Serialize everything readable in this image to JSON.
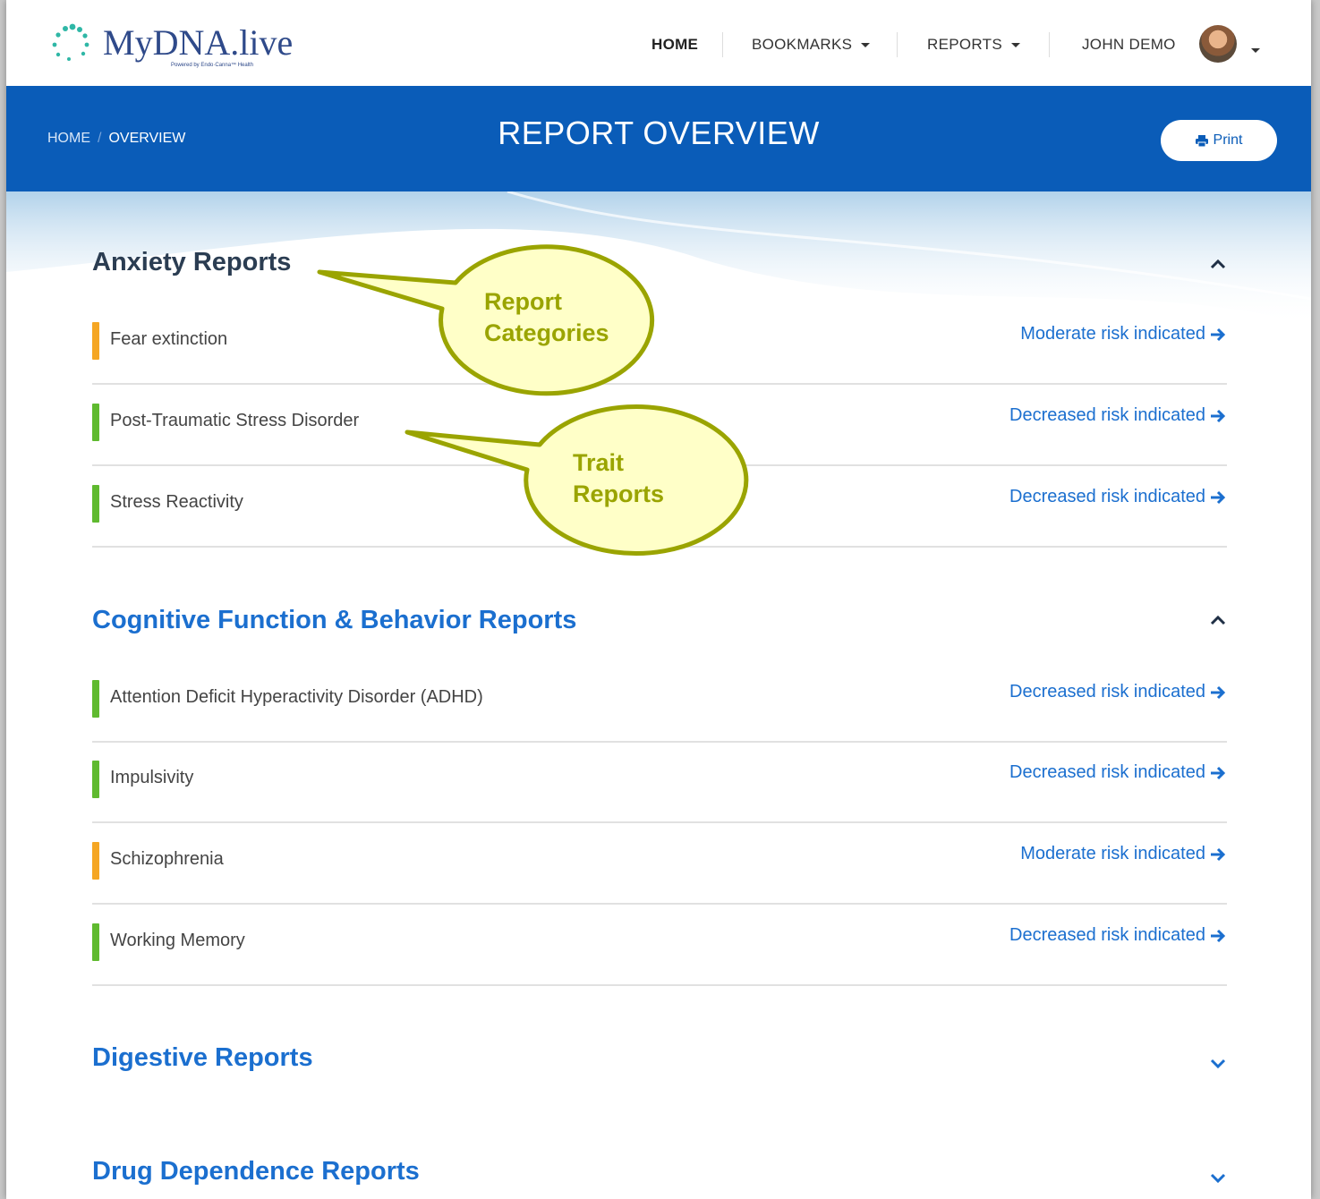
{
  "brand": {
    "name": "MyDNA",
    "tld": ".live",
    "tagline": "Powered by Endo·Canna™ Health"
  },
  "nav": {
    "home": "HOME",
    "bookmarks": "BOOKMARKS",
    "reports": "REPORTS",
    "user": "JOHN DEMO"
  },
  "header": {
    "breadcrumb_home": "HOME",
    "breadcrumb_sep": "/",
    "breadcrumb_current": "OVERVIEW",
    "title": "REPORT OVERVIEW",
    "print_label": "Print"
  },
  "colors": {
    "brand_blue": "#0a5cb8",
    "link_blue": "#1b6fcf",
    "moderate": "#f5a623",
    "decreased": "#5fba2f",
    "callout": "#9aa400"
  },
  "categories": [
    {
      "title": "Anxiety Reports",
      "expanded": true,
      "active": true,
      "traits": [
        {
          "name": "Fear extinction",
          "risk": "Moderate risk indicated",
          "level": "moderate"
        },
        {
          "name": "Post-Traumatic Stress Disorder",
          "risk": "Decreased risk indicated",
          "level": "decreased"
        },
        {
          "name": "Stress Reactivity",
          "risk": "Decreased risk indicated",
          "level": "decreased"
        }
      ]
    },
    {
      "title": "Cognitive Function & Behavior Reports",
      "expanded": true,
      "active": false,
      "traits": [
        {
          "name": "Attention Deficit Hyperactivity Disorder (ADHD)",
          "risk": "Decreased risk indicated",
          "level": "decreased"
        },
        {
          "name": "Impulsivity",
          "risk": "Decreased risk indicated",
          "level": "decreased"
        },
        {
          "name": "Schizophrenia",
          "risk": "Moderate risk indicated",
          "level": "moderate"
        },
        {
          "name": "Working Memory",
          "risk": "Decreased risk indicated",
          "level": "decreased"
        }
      ]
    },
    {
      "title": "Digestive Reports",
      "expanded": false,
      "active": false,
      "traits": []
    },
    {
      "title": "Drug Dependence Reports",
      "expanded": false,
      "active": false,
      "traits": []
    }
  ],
  "callouts": {
    "report_categories": [
      "Report",
      "Categories"
    ],
    "trait_reports": [
      "Trait",
      "Reports"
    ]
  }
}
